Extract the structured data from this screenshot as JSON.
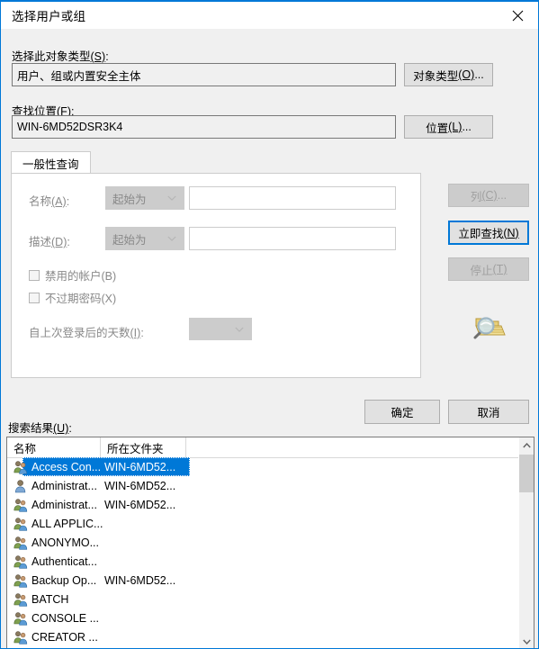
{
  "window": {
    "title": "选择用户或组",
    "close_icon": "close-icon"
  },
  "object_type": {
    "label_main": "选择此对象类型",
    "label_accel": "(S)",
    "label_colon": ":",
    "value": "用户、组或内置安全主体",
    "button_main": "对象类型",
    "button_accel": "(O)",
    "button_suffix": "..."
  },
  "location": {
    "label_main": "查找位置",
    "label_accel": "(F)",
    "label_colon": ":",
    "value": "WIN-6MD52DSR3K4",
    "button_main": "位置",
    "button_accel": "(L)",
    "button_suffix": "..."
  },
  "tab": {
    "label": "一般性查询"
  },
  "query": {
    "name_label_main": "名称",
    "name_label_accel": "(A)",
    "name_label_colon": ":",
    "name_condition": "起始为",
    "name_value": "",
    "desc_label_main": "描述",
    "desc_label_accel": "(D)",
    "desc_label_colon": ":",
    "desc_condition": "起始为",
    "desc_value": "",
    "disabled_account_main": "禁用的帐户",
    "disabled_account_accel": "(B)",
    "disabled_account_checked": false,
    "no_expire_pwd_main": "不过期密码",
    "no_expire_pwd_accel": "(X)",
    "no_expire_pwd_checked": false,
    "days_label_main": "自上次登录后的天数",
    "days_label_accel": "(I)",
    "days_label_colon": ":",
    "days_value": ""
  },
  "side_buttons": {
    "columns_main": "列",
    "columns_accel": "(C)",
    "columns_suffix": "...",
    "find_now_main": "立即查找",
    "find_now_accel": "(N)",
    "stop_main": "停止",
    "stop_accel": "(T)",
    "search_icon": "magnifier-folder-icon"
  },
  "footer": {
    "ok_label": "确定",
    "cancel_label": "取消"
  },
  "results": {
    "label_main": "搜索结果",
    "label_accel": "(U)",
    "label_colon": ":",
    "columns": [
      "名称",
      "所在文件夹",
      ""
    ],
    "rows": [
      {
        "name": "Access Con...",
        "folder": "WIN-6MD52...",
        "icon": "group-icon",
        "selected": true
      },
      {
        "name": "Administrat...",
        "folder": "WIN-6MD52...",
        "icon": "user-icon",
        "selected": false
      },
      {
        "name": "Administrat...",
        "folder": "WIN-6MD52...",
        "icon": "group-icon",
        "selected": false
      },
      {
        "name": "ALL APPLIC...",
        "folder": "",
        "icon": "group-icon",
        "selected": false
      },
      {
        "name": "ANONYMO...",
        "folder": "",
        "icon": "group-icon",
        "selected": false
      },
      {
        "name": "Authenticat...",
        "folder": "",
        "icon": "group-icon",
        "selected": false
      },
      {
        "name": "Backup Op...",
        "folder": "WIN-6MD52...",
        "icon": "group-icon",
        "selected": false
      },
      {
        "name": "BATCH",
        "folder": "",
        "icon": "group-icon",
        "selected": false
      },
      {
        "name": "CONSOLE ...",
        "folder": "",
        "icon": "group-icon",
        "selected": false
      },
      {
        "name": "CREATOR ...",
        "folder": "",
        "icon": "group-icon",
        "selected": false
      }
    ],
    "scrollbar": {
      "up_icon": "chevron-up-icon",
      "down_icon": "chevron-down-icon"
    }
  },
  "colors": {
    "accent": "#0078d7",
    "dialog_bg": "#f0f0f0",
    "selection": "#0078d7",
    "disabled_text": "#898989"
  }
}
